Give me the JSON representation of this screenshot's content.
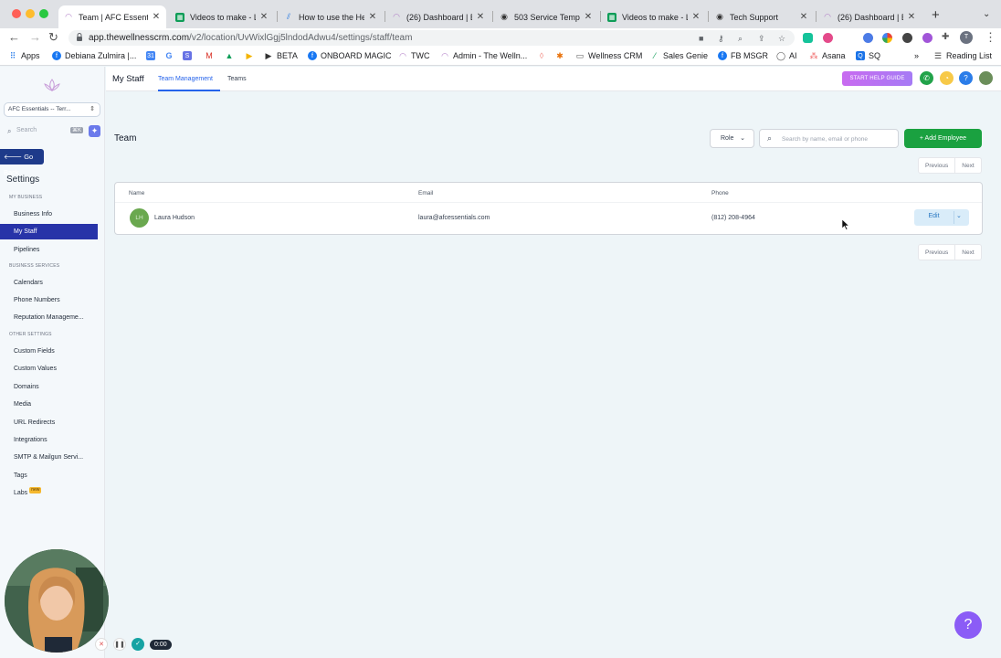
{
  "browser": {
    "tabs": [
      {
        "title": "Team | AFC Essenti",
        "active": true
      },
      {
        "title": "Videos to make - L"
      },
      {
        "title": "How to use the Hel"
      },
      {
        "title": "(26) Dashboard | E"
      },
      {
        "title": "503 Service Tempo"
      },
      {
        "title": "Videos to make - L"
      },
      {
        "title": "Tech Support"
      },
      {
        "title": "(26) Dashboard | E"
      }
    ],
    "url_host": "app.thewellnesscrm.com",
    "url_path": "/v2/location/UvWixlGgj5lndodAdwu4/settings/staff/team",
    "profile_initial": "T",
    "ext_badge": "1",
    "bookmarks": [
      {
        "label": "Apps"
      },
      {
        "label": "Debiana Zulmira |..."
      },
      {
        "label": "BETA"
      },
      {
        "label": "ONBOARD MAGIC"
      },
      {
        "label": "TWC"
      },
      {
        "label": "Admin - The Welln..."
      },
      {
        "label": "Wellness CRM"
      },
      {
        "label": "Sales Genie"
      },
      {
        "label": "FB MSGR"
      },
      {
        "label": "AI"
      },
      {
        "label": "Asana"
      },
      {
        "label": "SQ"
      },
      {
        "label": "»"
      },
      {
        "label": "Reading List"
      }
    ]
  },
  "sidebar": {
    "location_select": "AFC Essentials -- Terr...",
    "search_placeholder": "Search",
    "search_shortcut": "⌘K",
    "go_back": "Go Back",
    "heading": "Settings",
    "sections": {
      "my_business": "MY BUSINESS",
      "business_services": "BUSINESS SERVICES",
      "other_settings": "OTHER SETTINGS"
    },
    "items": [
      {
        "label": "Business Info"
      },
      {
        "label": "My Staff",
        "active": true
      },
      {
        "label": "Pipelines"
      },
      {
        "label": "Calendars"
      },
      {
        "label": "Phone Numbers"
      },
      {
        "label": "Reputation Manageme..."
      },
      {
        "label": "Custom Fields"
      },
      {
        "label": "Custom Values"
      },
      {
        "label": "Domains"
      },
      {
        "label": "Media"
      },
      {
        "label": "URL Redirects"
      },
      {
        "label": "Integrations"
      },
      {
        "label": "SMTP & Mailgun Servi..."
      },
      {
        "label": "Tags"
      },
      {
        "label": "Labs"
      }
    ],
    "labs_badge": "new"
  },
  "topnav": {
    "title": "My Staff",
    "tabs": [
      {
        "label": "Team Management",
        "active": true
      },
      {
        "label": "Teams"
      }
    ],
    "help_guide": "START HELP GUIDE"
  },
  "main": {
    "title": "Team",
    "role_filter": "Role",
    "search_placeholder": "Search by name, email or phone",
    "search_value": "",
    "add_employee": "+ Add Employee",
    "pagination": {
      "previous": "Previous",
      "next": "Next"
    },
    "table": {
      "columns": [
        "Name",
        "Email",
        "Phone"
      ],
      "rows": [
        {
          "initials": "LH",
          "name": "Laura Hudson",
          "email": "laura@afcessentials.com",
          "phone": "(812) 208-4964",
          "action": "Edit"
        }
      ]
    }
  },
  "recorder": {
    "time": "0:00"
  },
  "colors": {
    "sidebar_active": "#2733a8",
    "primary_green": "#1aa140",
    "link_blue": "#2563eb",
    "help_purple": "#8b5cf6"
  }
}
